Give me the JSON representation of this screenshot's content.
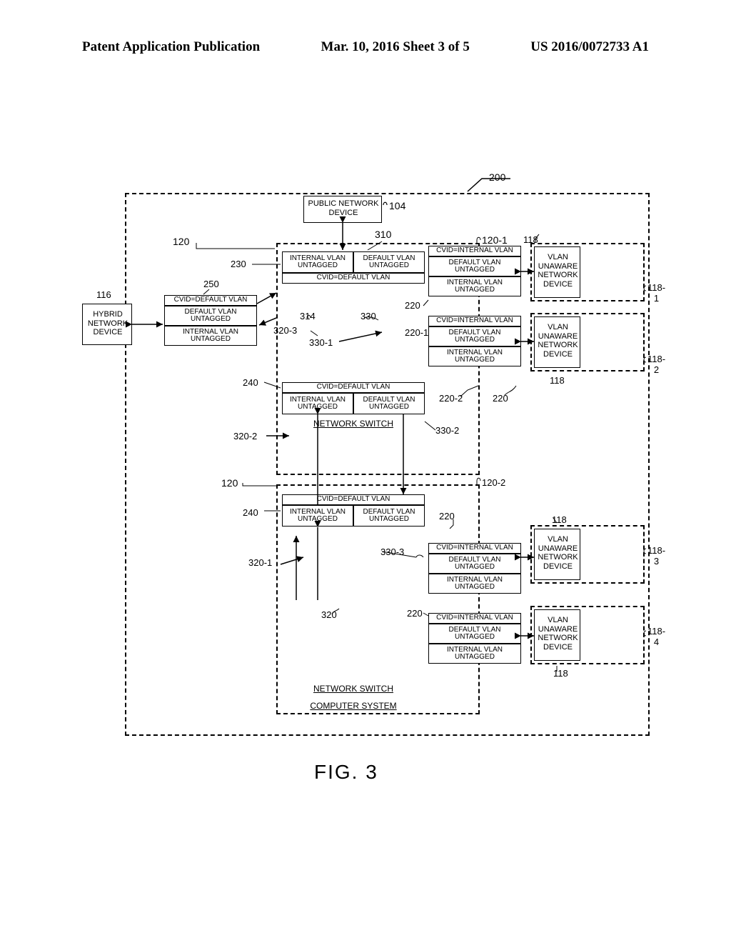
{
  "header": {
    "left": "Patent Application Publication",
    "center": "Mar. 10, 2016  Sheet 3 of 5",
    "right": "US 2016/0072733 A1"
  },
  "figure_caption": "FIG. 3",
  "labels": {
    "l200": "200",
    "l104": "104",
    "l310": "310",
    "l120_t": "120",
    "l120_1": "120-1",
    "l118_t": "118",
    "l118_1": "118-1",
    "l118_2": "118-2",
    "l118_tm": "118",
    "l116": "116",
    "l250": "250",
    "l230": "230",
    "l240a": "240",
    "l314": "314",
    "l330": "330",
    "l320_3": "320-3",
    "l330_1": "330-1",
    "l220_t": "220",
    "l220_1": "220-1",
    "l220_2": "220-2",
    "l220_r": "220",
    "l320_2": "320-2",
    "l330_2": "330-2",
    "l120_b": "120",
    "l120_2": "120-2",
    "l320_1": "320-1",
    "l240b": "240",
    "l330_3": "330-3",
    "l220_m": "220",
    "l118_m": "118",
    "l118_3": "118-3",
    "l220_b": "220",
    "l118_4": "118-4",
    "l118_b": "118",
    "l320": "320"
  },
  "boxes": {
    "public_net": "PUBLIC NETWORK\nDEVICE",
    "hybrid": "HYBRID\nNETWORK\nDEVICE",
    "vlan_unaware": "VLAN\nUNAWARE\nNETWORK\nDEVICE",
    "network_switch": "NETWORK SWITCH",
    "computer_system": "COMPUTER SYSTEM",
    "cvid_default": "CVID=DEFAULT VLAN",
    "cvid_internal": "CVID=INTERNAL VLAN",
    "internal_untagged": "INTERNAL VLAN\nUNTAGGED",
    "default_untagged": "DEFAULT VLAN\nUNTAGGED"
  }
}
